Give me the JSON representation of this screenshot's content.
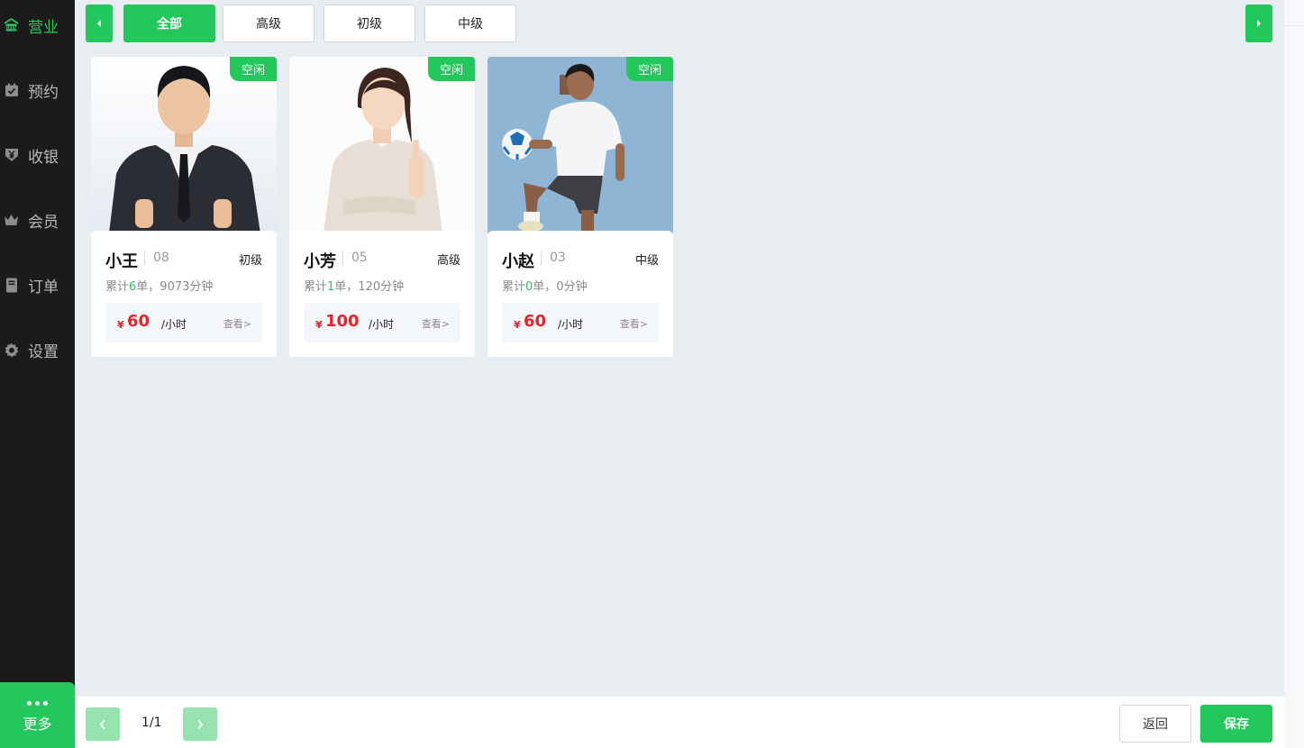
{
  "sidebar": {
    "items": [
      {
        "label": "营业",
        "icon": "open-shop-icon",
        "icon_text": "OPEN",
        "active": true
      },
      {
        "label": "预约",
        "icon": "calendar-check-icon"
      },
      {
        "label": "收银",
        "icon": "cashier-yen-icon"
      },
      {
        "label": "会员",
        "icon": "crown-icon"
      },
      {
        "label": "订单",
        "icon": "order-book-icon"
      },
      {
        "label": "设置",
        "icon": "gear-icon"
      }
    ],
    "more_label": "更多"
  },
  "tabs": [
    {
      "label": "全部",
      "active": true
    },
    {
      "label": "高级"
    },
    {
      "label": "初级"
    },
    {
      "label": "中级"
    }
  ],
  "cards": [
    {
      "status": "空闲",
      "name": "小王",
      "number": "08",
      "level": "初级",
      "stats_prefix": "累计",
      "orders": "6",
      "stats_suffix": "单，9073分钟",
      "currency": "¥",
      "price": "60",
      "unit": "/小时",
      "view": "查看>"
    },
    {
      "status": "空闲",
      "name": "小芳",
      "number": "05",
      "level": "高级",
      "stats_prefix": "累计",
      "orders": "1",
      "stats_suffix": "单，120分钟",
      "currency": "¥",
      "price": "100",
      "unit": "/小时",
      "view": "查看>"
    },
    {
      "status": "空闲",
      "name": "小赵",
      "number": "03",
      "level": "中级",
      "stats_prefix": "累计",
      "orders": "0",
      "stats_suffix": "单，0分钟",
      "currency": "¥",
      "price": "60",
      "unit": "/小时",
      "view": "查看>"
    }
  ],
  "footer": {
    "page_info": "1/1",
    "back_label": "返回",
    "save_label": "保存"
  },
  "colors": {
    "accent": "#23c85c",
    "price": "#e8222a",
    "sidebar_bg": "#1b1b1b"
  }
}
